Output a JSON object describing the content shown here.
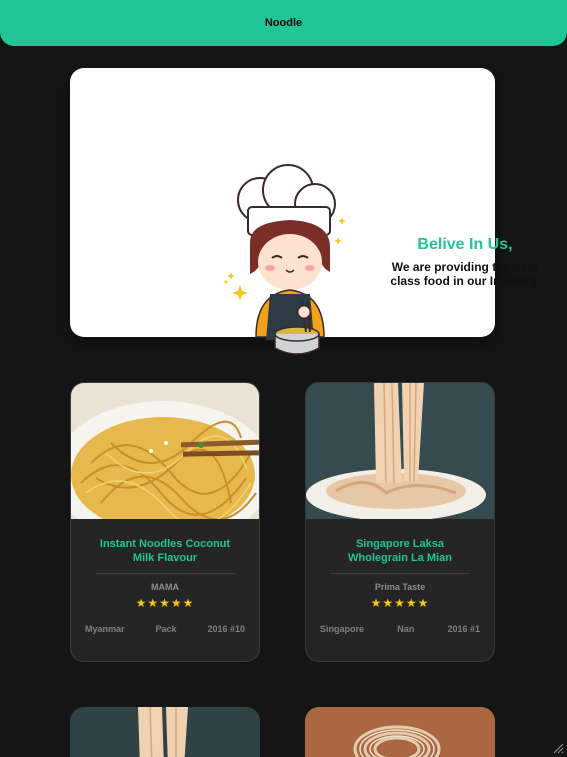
{
  "header": {
    "title": "Noodle"
  },
  "hero": {
    "headline": "Belive In Us,",
    "subtitle": "We are providing the best class food in our Industry."
  },
  "products": [
    {
      "title": "Instant Noodles Coconut Milk Flavour",
      "brand": "MAMA",
      "rating": 5,
      "stars": "★★★★★",
      "country": "Myanmar",
      "style": "Pack",
      "rank": "2016 #10"
    },
    {
      "title": "Singapore Laksa Wholegrain La Mian",
      "brand": "Prima Taste",
      "rating": 5,
      "stars": "★★★★★",
      "country": "Singapore",
      "style": "Nan",
      "rank": "2016 #1"
    }
  ],
  "colors": {
    "accent": "#22c595",
    "background": "#151515",
    "card": "#252525",
    "star": "#f6c516"
  }
}
